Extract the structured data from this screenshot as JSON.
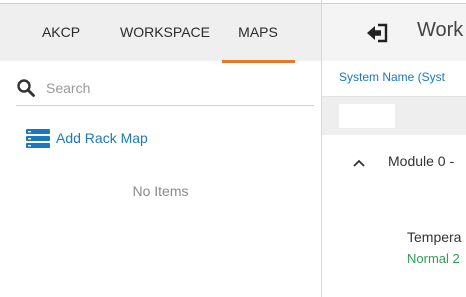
{
  "tabs": [
    {
      "label": "AKCP"
    },
    {
      "label": "WORKSPACE"
    },
    {
      "label": "MAPS"
    }
  ],
  "active_tab": "MAPS",
  "search": {
    "placeholder": "Search",
    "value": ""
  },
  "maps": {
    "add_rack_map_label": "Add Rack Map",
    "empty_text": "No Items"
  },
  "workspace": {
    "title": "Work",
    "column_header": "System Name (Syst",
    "module_label": "Module 0 -",
    "sensor_name": "Tempera",
    "sensor_status": "Normal 2"
  },
  "colors": {
    "accent_orange": "#e8762d",
    "link_blue": "#1a78c2",
    "status_green": "#2e9e54",
    "tab_bg": "#efefef"
  },
  "icons": [
    "search-icon",
    "rack-map-icon",
    "back-icon",
    "chevron-up-icon"
  ]
}
